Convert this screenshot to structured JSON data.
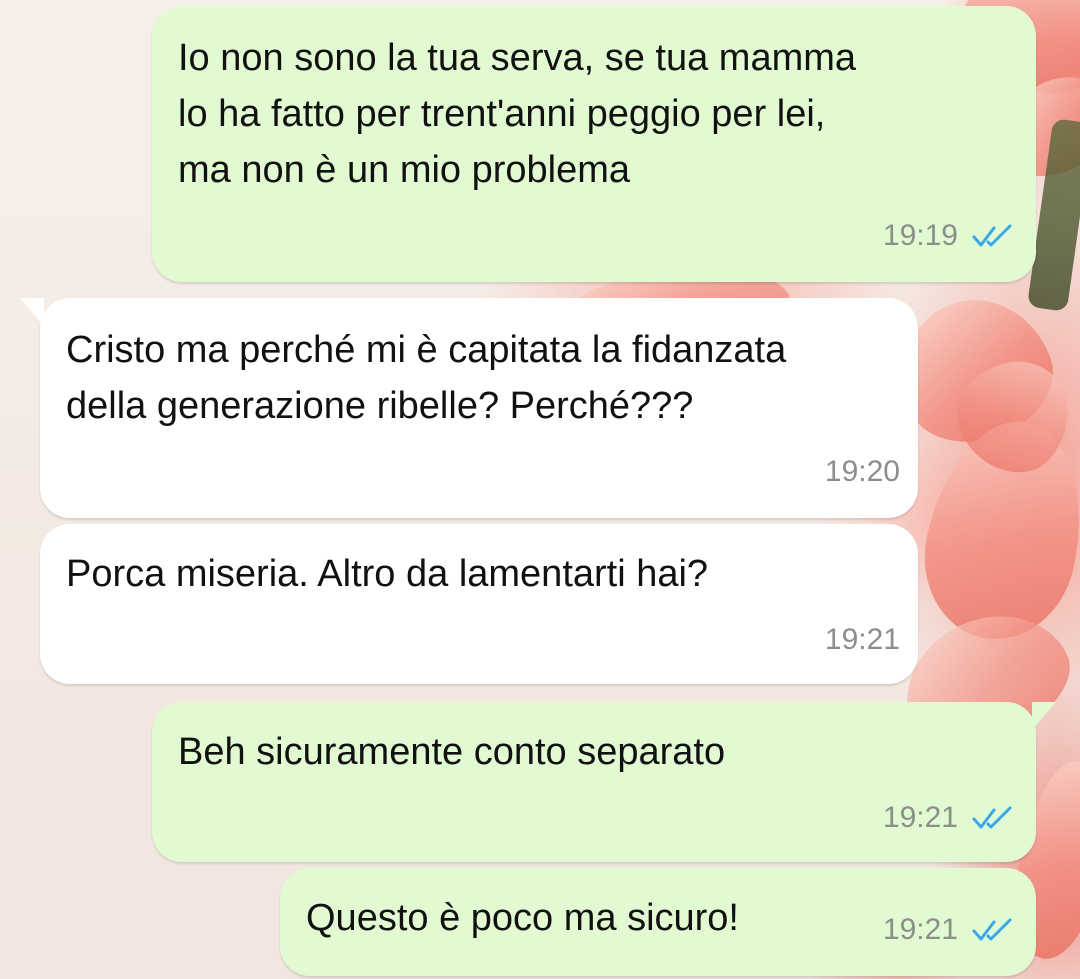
{
  "colors": {
    "outgoing_bubble": "#e1fad2",
    "incoming_bubble": "#ffffff",
    "read_ticks": "#3aa7e8",
    "timestamp": "#8a9088"
  },
  "icons": {
    "read_receipt": "double-check-icon"
  },
  "messages": [
    {
      "direction": "outgoing",
      "text": "Io non sono la tua serva, se tua mamma lo ha fatto per trent'anni peggio per lei, ma non è un mio problema",
      "time": "19:19",
      "read": true
    },
    {
      "direction": "incoming",
      "text": "Cristo ma perché mi è capitata la fidanzata della generazione ribelle? Perché???",
      "time": "19:20"
    },
    {
      "direction": "incoming",
      "text": "Porca miseria. Altro da lamentarti hai?",
      "time": "19:21"
    },
    {
      "direction": "outgoing",
      "text": "Beh sicuramente conto separato",
      "time": "19:21",
      "read": true
    },
    {
      "direction": "outgoing",
      "text": "Questo è poco ma sicuro!",
      "time": "19:21",
      "read": true
    }
  ]
}
